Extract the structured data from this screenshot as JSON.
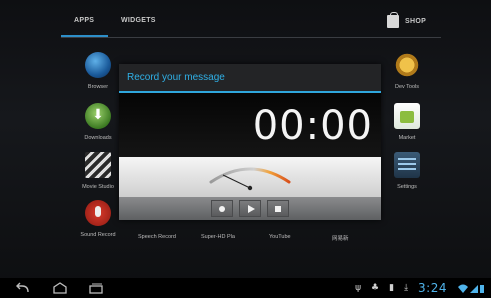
{
  "tabs": {
    "apps": "APPS",
    "widgets": "WIDGETS",
    "shop": "SHOP"
  },
  "apps": {
    "browser": "Browser",
    "downloads": "Downloads",
    "movie_studio": "Movie Studio",
    "sound_recorder": "Sound Record",
    "dev_tools": "Dev Tools",
    "market": "Market",
    "settings": "Settings"
  },
  "bottom_row": [
    "Speech Record",
    "Super-HD Pla",
    "YouTube",
    "网易新"
  ],
  "dialog": {
    "title": "Record your message",
    "timer": "00:00",
    "controls": {
      "record": "record",
      "play": "play",
      "stop": "stop"
    }
  },
  "status": {
    "clock": "3:24"
  },
  "colors": {
    "accent": "#2fb0e6",
    "clock": "#4fb3ea"
  },
  "icons": [
    "back-icon",
    "home-icon",
    "recent-apps-icon",
    "usb-icon",
    "android-debug-icon",
    "sd-card-icon",
    "download-icon",
    "wifi-icon",
    "signal-icon",
    "battery-icon"
  ]
}
